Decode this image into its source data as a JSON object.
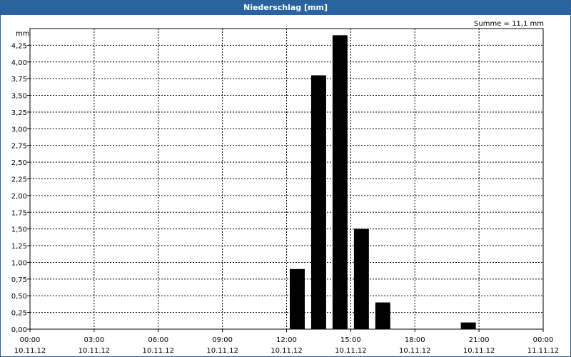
{
  "window": {
    "title": "Niederschlag [mm]"
  },
  "chart_data": {
    "type": "bar",
    "title": "Niederschlag [mm]",
    "ylabel": "mm",
    "annotation": "Summe = 11,1 mm",
    "ylim": [
      0,
      4.5
    ],
    "yticks": [
      "0,00",
      "0,25",
      "0,50",
      "0,75",
      "1,00",
      "1,25",
      "1,50",
      "1,75",
      "2,00",
      "2,25",
      "2,50",
      "2,75",
      "3,00",
      "3,25",
      "3,50",
      "3,75",
      "4,00",
      "4,25"
    ],
    "xticks": [
      {
        "time": "00:00",
        "date": "10.11.12"
      },
      {
        "time": "03:00",
        "date": "10.11.12"
      },
      {
        "time": "06:00",
        "date": "10.11.12"
      },
      {
        "time": "09:00",
        "date": "10.11.12"
      },
      {
        "time": "12:00",
        "date": "10.11.12"
      },
      {
        "time": "15:00",
        "date": "10.11.12"
      },
      {
        "time": "18:00",
        "date": "10.11.12"
      },
      {
        "time": "21:00",
        "date": "10.11.12"
      },
      {
        "time": "00:00",
        "date": "11.11.12"
      }
    ],
    "x_range_hours": [
      0,
      24
    ],
    "grid": true,
    "bar_color": "#000000",
    "bars": [
      {
        "start_hour": 12,
        "end_hour": 13,
        "value": 0.9
      },
      {
        "start_hour": 13,
        "end_hour": 14,
        "value": 3.8
      },
      {
        "start_hour": 14,
        "end_hour": 15,
        "value": 4.4
      },
      {
        "start_hour": 15,
        "end_hour": 16,
        "value": 1.5
      },
      {
        "start_hour": 16,
        "end_hour": 17,
        "value": 0.4
      },
      {
        "start_hour": 20,
        "end_hour": 21,
        "value": 0.1
      }
    ]
  }
}
